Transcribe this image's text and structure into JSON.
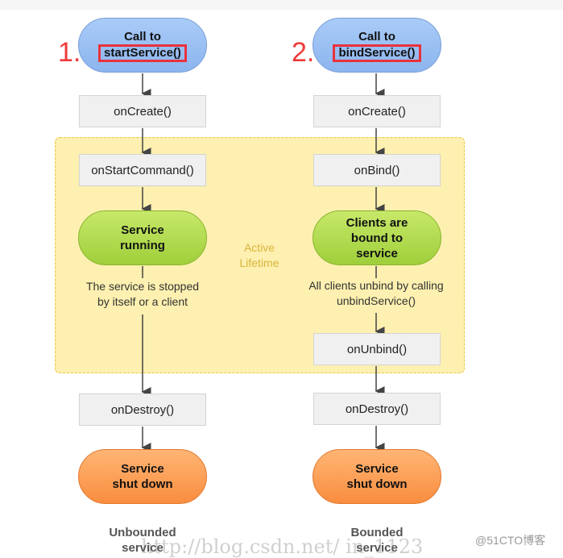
{
  "left": {
    "number": "1.",
    "call_line1": "Call to",
    "call_line2": "startService()",
    "on_create": "onCreate()",
    "on_start_command": "onStartCommand()",
    "running_line1": "Service",
    "running_line2": "running",
    "note_line1": "The service is stopped",
    "note_line2": "by itself or a client",
    "on_destroy": "onDestroy()",
    "end_line1": "Service",
    "end_line2": "shut down",
    "caption_line1": "Unbounded",
    "caption_line2": "service"
  },
  "right": {
    "number": "2.",
    "call_line1": "Call to",
    "call_line2": "bindService()",
    "on_create": "onCreate()",
    "on_bind": "onBind()",
    "bound_line1": "Clients are",
    "bound_line2": "bound to",
    "bound_line3": "service",
    "note_line1": "All clients unbind by calling",
    "note_line2": "unbindService()",
    "on_unbind": "onUnbind()",
    "on_destroy": "onDestroy()",
    "end_line1": "Service",
    "end_line2": "shut down",
    "caption_line1": "Bounded",
    "caption_line2": "service"
  },
  "active_lifetime": {
    "line1": "Active",
    "line2": "Lifetime"
  },
  "watermark": "http://blog.csdn.net/    in_1123",
  "site_mark": "@51CTO博客",
  "colors": {
    "highlight": "#e8323c",
    "start": "#9cc0f3",
    "running": "#b5dc50",
    "end": "#fca05a",
    "region": "#fdf0b0"
  }
}
